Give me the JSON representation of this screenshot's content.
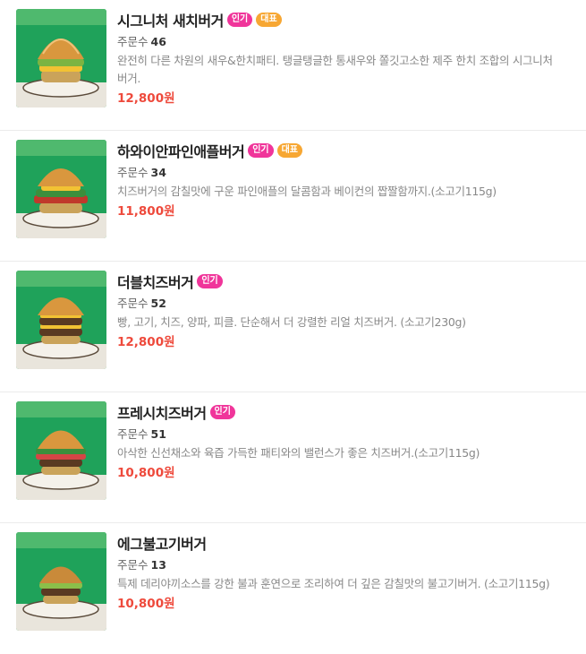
{
  "menu": {
    "items": [
      {
        "name": "시그니처 새치버거",
        "badges": [
          {
            "label": "인기",
            "type": "popular"
          },
          {
            "label": "대표",
            "type": "rep"
          }
        ],
        "orders_label": "주문수",
        "orders": "46",
        "description": "완전히 다른 차원의 새우&한치패티. 탱글탱글한 통새우와 쫄깃고소한 제주 한치 조합의 시그니처 버거.",
        "price": "12,800원",
        "image_icon": "burger-photo-icon"
      },
      {
        "name": "하와이안파인애플버거",
        "badges": [
          {
            "label": "인기",
            "type": "popular"
          },
          {
            "label": "대표",
            "type": "rep"
          }
        ],
        "orders_label": "주문수",
        "orders": "34",
        "description": "치즈버거의 감칠맛에 구운 파인애플의 달콤함과 베이컨의 짭짤함까지.(소고기115g)",
        "price": "11,800원",
        "image_icon": "burger-photo-icon"
      },
      {
        "name": "더블치즈버거",
        "badges": [
          {
            "label": "인기",
            "type": "popular"
          }
        ],
        "orders_label": "주문수",
        "orders": "52",
        "description": "빵, 고기, 치즈, 양파, 피클. 단순해서 더 강렬한 리얼 치즈버거. (소고기230g)",
        "price": "12,800원",
        "image_icon": "burger-photo-icon"
      },
      {
        "name": "프레시치즈버거",
        "badges": [
          {
            "label": "인기",
            "type": "popular"
          }
        ],
        "orders_label": "주문수",
        "orders": "51",
        "description": "아삭한 신선채소와 육즙 가득한 패티와의 밸런스가 좋은 치즈버거.(소고기115g)",
        "price": "10,800원",
        "image_icon": "burger-photo-icon"
      },
      {
        "name": "에그불고기버거",
        "badges": [],
        "orders_label": "주문수",
        "orders": "13",
        "description": "특제 데리야끼소스를 강한 불과 훈연으로 조리하여 더 깊은 감칠맛의 불고기버거. (소고기115g)",
        "price": "10,800원",
        "image_icon": "burger-photo-icon"
      }
    ]
  },
  "colors": {
    "badge_popular": "#f0359a",
    "badge_rep": "#f7a733",
    "price": "#ee4a3c",
    "photo_bg": "#1fa25a"
  }
}
